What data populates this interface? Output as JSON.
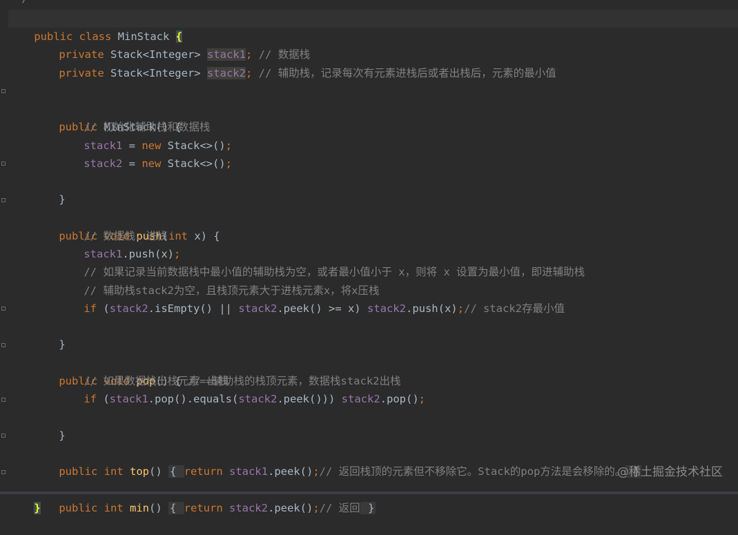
{
  "editor": {
    "top_comment": "*/",
    "watermark": "@稀土掘金技术社区",
    "lines": {
      "l1": {
        "a": "public class ",
        "b": "MinStack ",
        "c": "{"
      },
      "l2": {
        "a": "private ",
        "b": "Stack<Integer> ",
        "c": "stack1",
        "d": "; ",
        "e": "// 数据栈"
      },
      "l3": {
        "a": "private ",
        "b": "Stack<Integer> ",
        "c": "stack2",
        "d": "; ",
        "e": "// 辅助栈，记录每次有元素进栈后或者出栈后，元素的最小值"
      },
      "l4": {
        "a": "public ",
        "b": "MinStack",
        "c": "() {"
      },
      "l5": {
        "a": "// 初始化辅助栈和数据栈"
      },
      "l6": {
        "a": "stack1",
        "b": " = ",
        "c": "new ",
        "d": "Stack<>()",
        "e": ";"
      },
      "l7": {
        "a": "stack2",
        "b": " = ",
        "c": "new ",
        "d": "Stack<>()",
        "e": ";"
      },
      "l8": {
        "a": "}"
      },
      "l9": {
        "a": "public void ",
        "b": "push",
        "c": "(",
        "d": "int ",
        "e": "x) {"
      },
      "l10": {
        "a": "// 数据栈，进栈"
      },
      "l11": {
        "a": "stack1",
        "b": ".push(x)",
        "c": ";"
      },
      "l12": {
        "a": "// 如果记录当前数据栈中最小值的辅助栈为空，或者最小值小于 x，则将 x 设置为最小值，即进辅助栈"
      },
      "l13": {
        "a": "// 辅助栈stack2为空，且栈顶元素大于进栈元素x，将x压栈"
      },
      "l14": {
        "a": "if ",
        "b": "(",
        "c": "stack2",
        "d": ".isEmpty() || ",
        "e": "stack2",
        "f": ".peek() >= x) ",
        "g": "stack2",
        "h": ".push(x)",
        "i": ";",
        "j": "// stack2存最小值"
      },
      "l15": {
        "a": "}"
      },
      "l16": {
        "a": "public void ",
        "b": "pop",
        "c": "() { ",
        "d": "// 出栈"
      },
      "l17": {
        "a": "// 如果数据栈出栈元素==辅助栈的栈顶元素，数据栈stack2出栈"
      },
      "l18": {
        "a": "if ",
        "b": "(",
        "c": "stack1",
        "d": ".pop().equals(",
        "e": "stack2",
        "f": ".peek())) ",
        "g": "stack2",
        "h": ".pop()",
        "i": ";"
      },
      "l19": {
        "a": "}"
      },
      "l20": {
        "a": "public int ",
        "b": "top",
        "c": "() ",
        "d": "{ ",
        "e": "return ",
        "f": "stack1",
        "g": ".peek()",
        "h": ";",
        "i": "// 返回栈顶的元素但不移除它。Stack的pop方法是会移除的。",
        "j": " }"
      },
      "l21": {
        "a": "public int ",
        "b": "min",
        "c": "() ",
        "d": "{ ",
        "e": "return ",
        "f": "stack2",
        "g": ".peek()",
        "h": ";",
        "i": "// 返回",
        "j": " }"
      },
      "l22": {
        "a": "}"
      }
    }
  },
  "colors": {
    "background": "#2b2b2b",
    "keyword": "#cc7832",
    "field": "#9876aa",
    "comment": "#808080",
    "method": "#ffc66d",
    "text": "#a9b7c6"
  }
}
